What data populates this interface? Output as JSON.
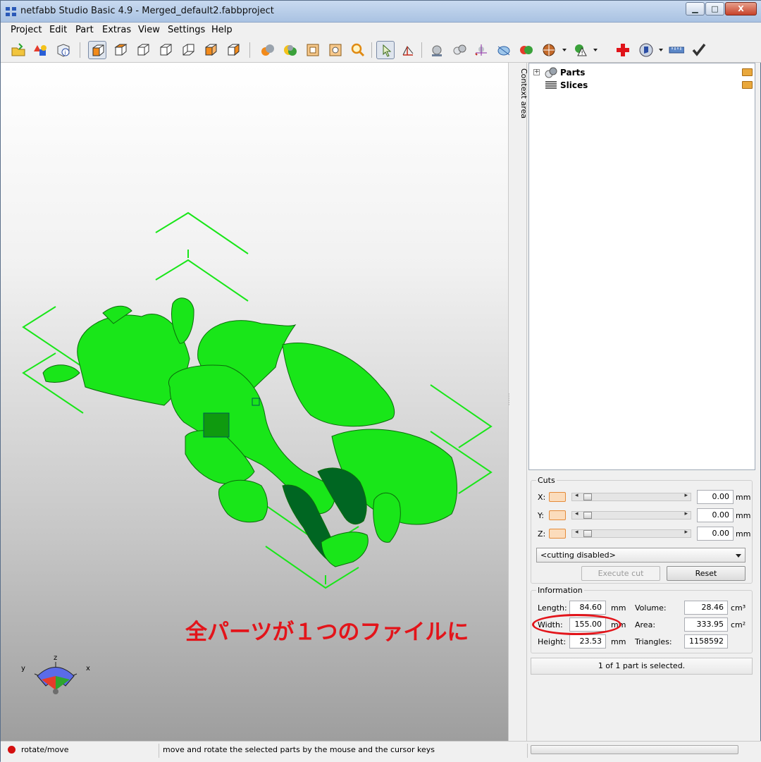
{
  "window": {
    "title": "netfabb Studio Basic 4.9 - Merged_default2.fabbproject",
    "minimize": "▁",
    "maximize": "□",
    "close": "X"
  },
  "menu": [
    "Project",
    "Edit",
    "Part",
    "Extras",
    "View",
    "Settings",
    "Help"
  ],
  "context_area": {
    "label": "Context area"
  },
  "tree": {
    "items": [
      {
        "label": "Parts",
        "expander": "+"
      },
      {
        "label": "Slices"
      }
    ]
  },
  "cuts": {
    "title": "Cuts",
    "rows": [
      {
        "axis": "X:",
        "value": "0.00",
        "unit": "mm"
      },
      {
        "axis": "Y:",
        "value": "0.00",
        "unit": "mm"
      },
      {
        "axis": "Z:",
        "value": "0.00",
        "unit": "mm"
      }
    ],
    "mode": "<cutting disabled>",
    "execute_label": "Execute cut",
    "reset_label": "Reset"
  },
  "information": {
    "title": "Information",
    "length": {
      "label": "Length:",
      "value": "84.60",
      "unit": "mm"
    },
    "width": {
      "label": "Width:",
      "value": "155.00",
      "unit": "mm"
    },
    "height": {
      "label": "Height:",
      "value": "23.53",
      "unit": "mm"
    },
    "volume": {
      "label": "Volume:",
      "value": "28.46",
      "unit": "cm³"
    },
    "area": {
      "label": "Area:",
      "value": "333.95",
      "unit": "cm²"
    },
    "triangles": {
      "label": "Triangles:",
      "value": "1158592"
    }
  },
  "selection_status": "1 of 1 part is selected.",
  "status": {
    "mode": "rotate/move",
    "hint": "move and rotate the selected parts by the mouse and the cursor keys"
  },
  "annotation": "全パーツが１つのファイルに",
  "axes": {
    "x": "x",
    "y": "y",
    "z": "z"
  },
  "colors": {
    "model": "#19e619",
    "annotation_red": "#e3141a",
    "swatch_orange": "#e58b3a"
  }
}
